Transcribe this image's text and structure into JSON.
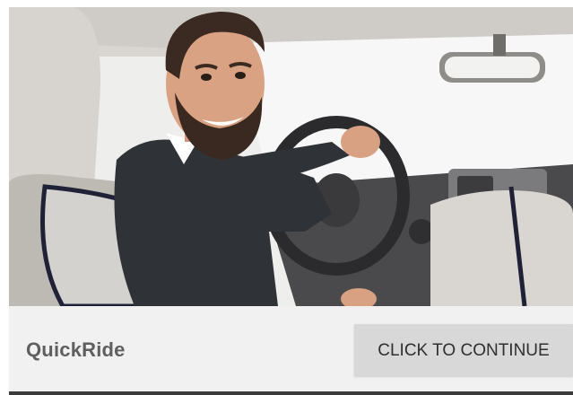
{
  "app": {
    "name": "QuickRide"
  },
  "actions": {
    "continue_label": "CLICK TO CONTINUE"
  },
  "hero_image": {
    "icon": "driver-photo"
  },
  "colors": {
    "bar_background": "#f1f1f1",
    "button_background": "#d8d8d8",
    "title_text": "#5f5f5f",
    "button_text": "#2f2f2f"
  }
}
